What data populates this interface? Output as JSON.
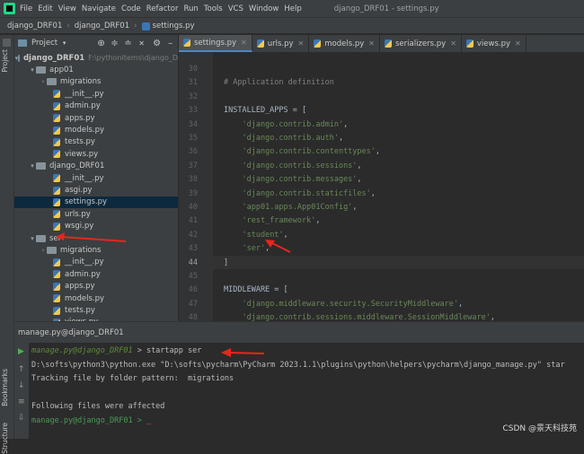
{
  "menubar": {
    "items": [
      "File",
      "Edit",
      "View",
      "Navigate",
      "Code",
      "Refactor",
      "Run",
      "Tools",
      "VCS",
      "Window",
      "Help"
    ],
    "window_title": "django_DRF01 - settings.py"
  },
  "breadcrumb": [
    "django_DRF01",
    "django_DRF01",
    "settings.py"
  ],
  "left_stripe": {
    "project": "Project",
    "bookmarks": "Bookmarks",
    "structure": "Structure"
  },
  "project_panel": {
    "title": "Project",
    "tree": [
      {
        "label": "django_DRF01",
        "hint": "F:\\pythonItems\\django_D",
        "type": "root",
        "indent": 0,
        "arrow": "v"
      },
      {
        "label": "app01",
        "type": "folder",
        "indent": 1,
        "arrow": "v"
      },
      {
        "label": "migrations",
        "type": "folder",
        "indent": 2,
        "arrow": ">"
      },
      {
        "label": "__init__.py",
        "type": "py",
        "indent": 3
      },
      {
        "label": "admin.py",
        "type": "py",
        "indent": 3
      },
      {
        "label": "apps.py",
        "type": "py",
        "indent": 3
      },
      {
        "label": "models.py",
        "type": "py",
        "indent": 3
      },
      {
        "label": "tests.py",
        "type": "py",
        "indent": 3
      },
      {
        "label": "views.py",
        "type": "py",
        "indent": 3
      },
      {
        "label": "django_DRF01",
        "type": "folder",
        "indent": 1,
        "arrow": "v"
      },
      {
        "label": "__init__.py",
        "type": "py",
        "indent": 3
      },
      {
        "label": "asgi.py",
        "type": "py",
        "indent": 3
      },
      {
        "label": "settings.py",
        "type": "py",
        "indent": 3,
        "selected": true
      },
      {
        "label": "urls.py",
        "type": "py",
        "indent": 3
      },
      {
        "label": "wsgi.py",
        "type": "py",
        "indent": 3
      },
      {
        "label": "ser",
        "type": "folder",
        "indent": 1,
        "arrow": "v"
      },
      {
        "label": "migrations",
        "type": "folder",
        "indent": 2,
        "arrow": ">"
      },
      {
        "label": "__init__.py",
        "type": "py",
        "indent": 3
      },
      {
        "label": "admin.py",
        "type": "py",
        "indent": 3
      },
      {
        "label": "apps.py",
        "type": "py",
        "indent": 3
      },
      {
        "label": "models.py",
        "type": "py",
        "indent": 3
      },
      {
        "label": "tests.py",
        "type": "py",
        "indent": 3
      },
      {
        "label": "views.py",
        "type": "py",
        "indent": 3
      }
    ]
  },
  "tabs": [
    {
      "label": "settings.py",
      "active": true
    },
    {
      "label": "urls.py",
      "active": false
    },
    {
      "label": "models.py",
      "active": false
    },
    {
      "label": "serializers.py",
      "active": false
    },
    {
      "label": "views.py",
      "active": false
    }
  ],
  "editor": {
    "lines": [
      {
        "n": "30",
        "parts": []
      },
      {
        "n": "31",
        "parts": [
          {
            "t": "cmt",
            "v": "# Application definition"
          }
        ]
      },
      {
        "n": "32",
        "parts": []
      },
      {
        "n": "33",
        "parts": [
          {
            "t": "plain",
            "v": "INSTALLED_APPS = ["
          }
        ]
      },
      {
        "n": "34",
        "parts": [
          {
            "t": "plain",
            "v": "    "
          },
          {
            "t": "str",
            "v": "'django.contrib.admin'"
          },
          {
            "t": "plain",
            "v": ","
          }
        ]
      },
      {
        "n": "35",
        "parts": [
          {
            "t": "plain",
            "v": "    "
          },
          {
            "t": "str",
            "v": "'django.contrib.auth'"
          },
          {
            "t": "plain",
            "v": ","
          }
        ]
      },
      {
        "n": "36",
        "parts": [
          {
            "t": "plain",
            "v": "    "
          },
          {
            "t": "str",
            "v": "'django.contrib.contenttypes'"
          },
          {
            "t": "plain",
            "v": ","
          }
        ]
      },
      {
        "n": "37",
        "parts": [
          {
            "t": "plain",
            "v": "    "
          },
          {
            "t": "str",
            "v": "'django.contrib.sessions'"
          },
          {
            "t": "plain",
            "v": ","
          }
        ]
      },
      {
        "n": "38",
        "parts": [
          {
            "t": "plain",
            "v": "    "
          },
          {
            "t": "str",
            "v": "'django.contrib.messages'"
          },
          {
            "t": "plain",
            "v": ","
          }
        ]
      },
      {
        "n": "39",
        "parts": [
          {
            "t": "plain",
            "v": "    "
          },
          {
            "t": "str",
            "v": "'django.contrib.staticfiles'"
          },
          {
            "t": "plain",
            "v": ","
          }
        ]
      },
      {
        "n": "40",
        "parts": [
          {
            "t": "plain",
            "v": "    "
          },
          {
            "t": "str",
            "v": "'app01.apps.App01Config'"
          },
          {
            "t": "plain",
            "v": ","
          }
        ]
      },
      {
        "n": "41",
        "parts": [
          {
            "t": "plain",
            "v": "    "
          },
          {
            "t": "str",
            "v": "'rest_framework'"
          },
          {
            "t": "plain",
            "v": ","
          }
        ]
      },
      {
        "n": "42",
        "parts": [
          {
            "t": "plain",
            "v": "    "
          },
          {
            "t": "str",
            "v": "'student'"
          },
          {
            "t": "plain",
            "v": ","
          }
        ]
      },
      {
        "n": "43",
        "parts": [
          {
            "t": "plain",
            "v": "    "
          },
          {
            "t": "str",
            "v": "'ser'"
          },
          {
            "t": "plain",
            "v": ","
          }
        ]
      },
      {
        "n": "44",
        "parts": [
          {
            "t": "plain",
            "v": "]"
          }
        ],
        "current": true
      },
      {
        "n": "45",
        "parts": []
      },
      {
        "n": "46",
        "parts": [
          {
            "t": "plain",
            "v": "MIDDLEWARE = ["
          }
        ]
      },
      {
        "n": "47",
        "parts": [
          {
            "t": "plain",
            "v": "    "
          },
          {
            "t": "str",
            "v": "'django.middleware.security.SecurityMiddleware'"
          },
          {
            "t": "plain",
            "v": ","
          }
        ]
      },
      {
        "n": "48",
        "parts": [
          {
            "t": "plain",
            "v": "    "
          },
          {
            "t": "str",
            "v": "'django.contrib.sessions.middleware.SessionMiddleware'"
          },
          {
            "t": "plain",
            "v": ","
          }
        ]
      }
    ]
  },
  "run_panel": {
    "title": "manage.py@django_DRF01",
    "console": [
      {
        "parts": [
          {
            "t": "prompt",
            "v": "manage.py@django_DRF01"
          },
          {
            "t": "plain",
            "v": " > startapp ser"
          }
        ]
      },
      {
        "parts": [
          {
            "t": "plain",
            "v": "D:\\softs\\python3\\python.exe \"D:\\softs\\pycharm\\PyCharm 2023.1.1\\plugins\\python\\helpers\\pycharm\\django_manage.py\" star"
          }
        ]
      },
      {
        "parts": [
          {
            "t": "plain",
            "v": "Tracking file by folder pattern:  migrations"
          }
        ]
      },
      {
        "parts": []
      },
      {
        "parts": [
          {
            "t": "plain",
            "v": "Following files were affected"
          }
        ]
      },
      {
        "parts": [
          {
            "t": "prompt-green",
            "v": "manage.py@django_DRF01 > "
          },
          {
            "t": "caret",
            "v": "_"
          }
        ]
      }
    ]
  },
  "watermark": "CSDN @景天科技苑",
  "colors": {
    "annotation_arrow": "#e8261c",
    "selection": "#0d293e",
    "string": "#6a8759",
    "comment": "#808080"
  }
}
